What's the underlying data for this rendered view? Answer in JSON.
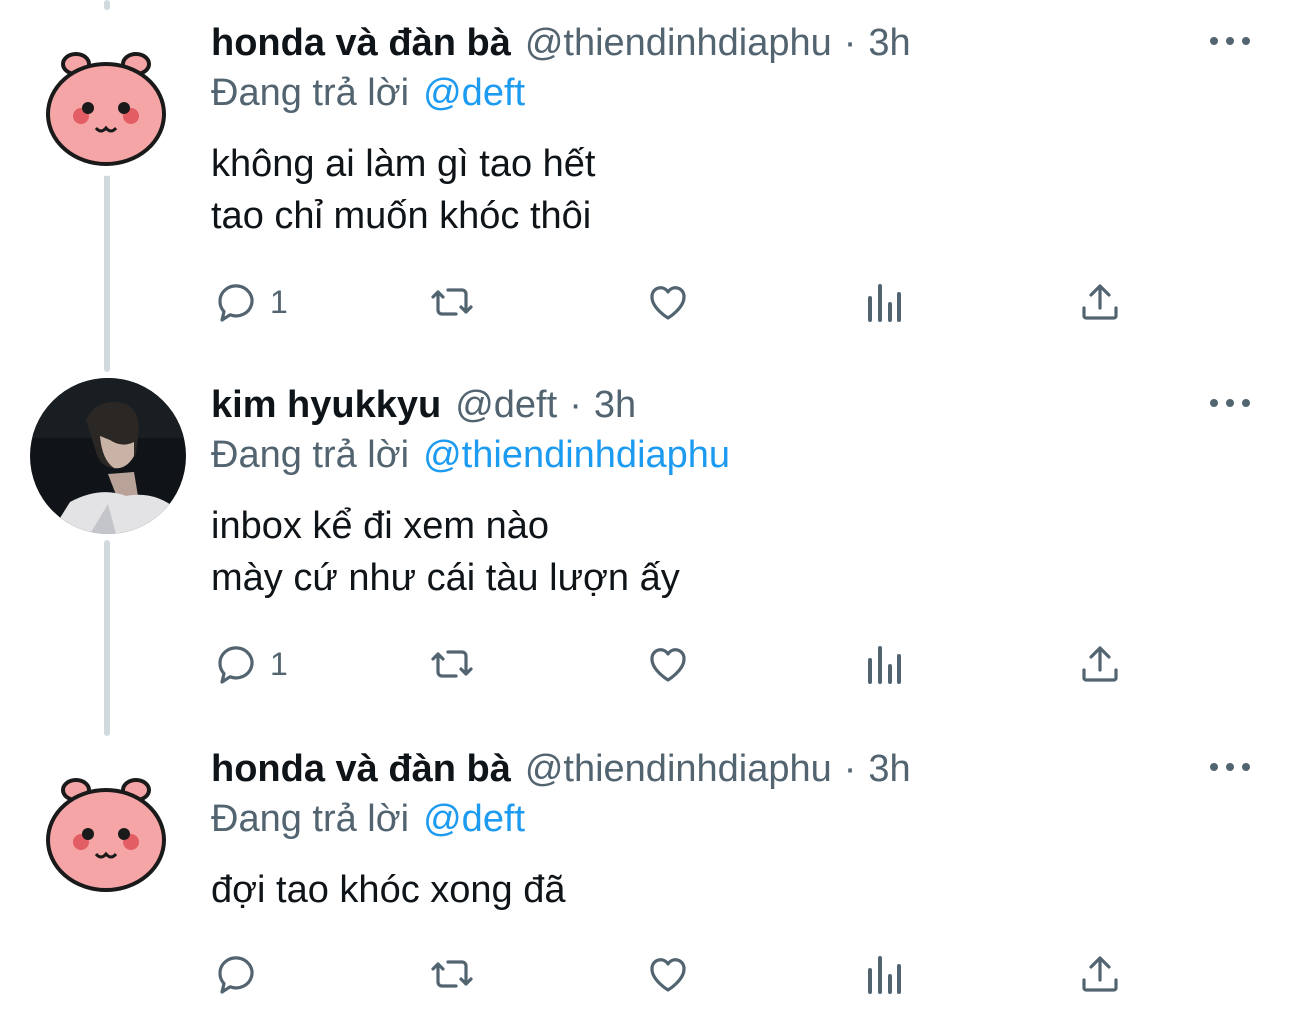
{
  "labels": {
    "replying_to": "Đang trả lời",
    "separator": "·"
  },
  "colors": {
    "text": "#0f1419",
    "secondary": "#536471",
    "link": "#1d9bf0",
    "thread_line": "#cfd9de",
    "pig_face": "#f6a5a6"
  },
  "tweets": [
    {
      "display_name": "honda và đàn bà",
      "handle": "@thiendinhdiaphu",
      "time": "3h",
      "replying_to": "@deft",
      "lines": [
        "không ai làm gì tao hết",
        "tao chỉ muốn khóc thôi"
      ],
      "avatar_icon": "pig-avatar",
      "reply_count": "1"
    },
    {
      "display_name": "kim hyukkyu",
      "handle": "@deft",
      "time": "3h",
      "replying_to": "@thiendinhdiaphu",
      "lines": [
        "inbox kể đi xem nào",
        "mày cứ như cái tàu lượn ấy"
      ],
      "avatar_icon": "person-photo-avatar",
      "reply_count": "1"
    },
    {
      "display_name": "honda và đàn bà",
      "handle": "@thiendinhdiaphu",
      "time": "3h",
      "replying_to": "@deft",
      "lines": [
        "đợi tao khóc xong đã"
      ],
      "avatar_icon": "pig-avatar",
      "reply_count": ""
    }
  ]
}
